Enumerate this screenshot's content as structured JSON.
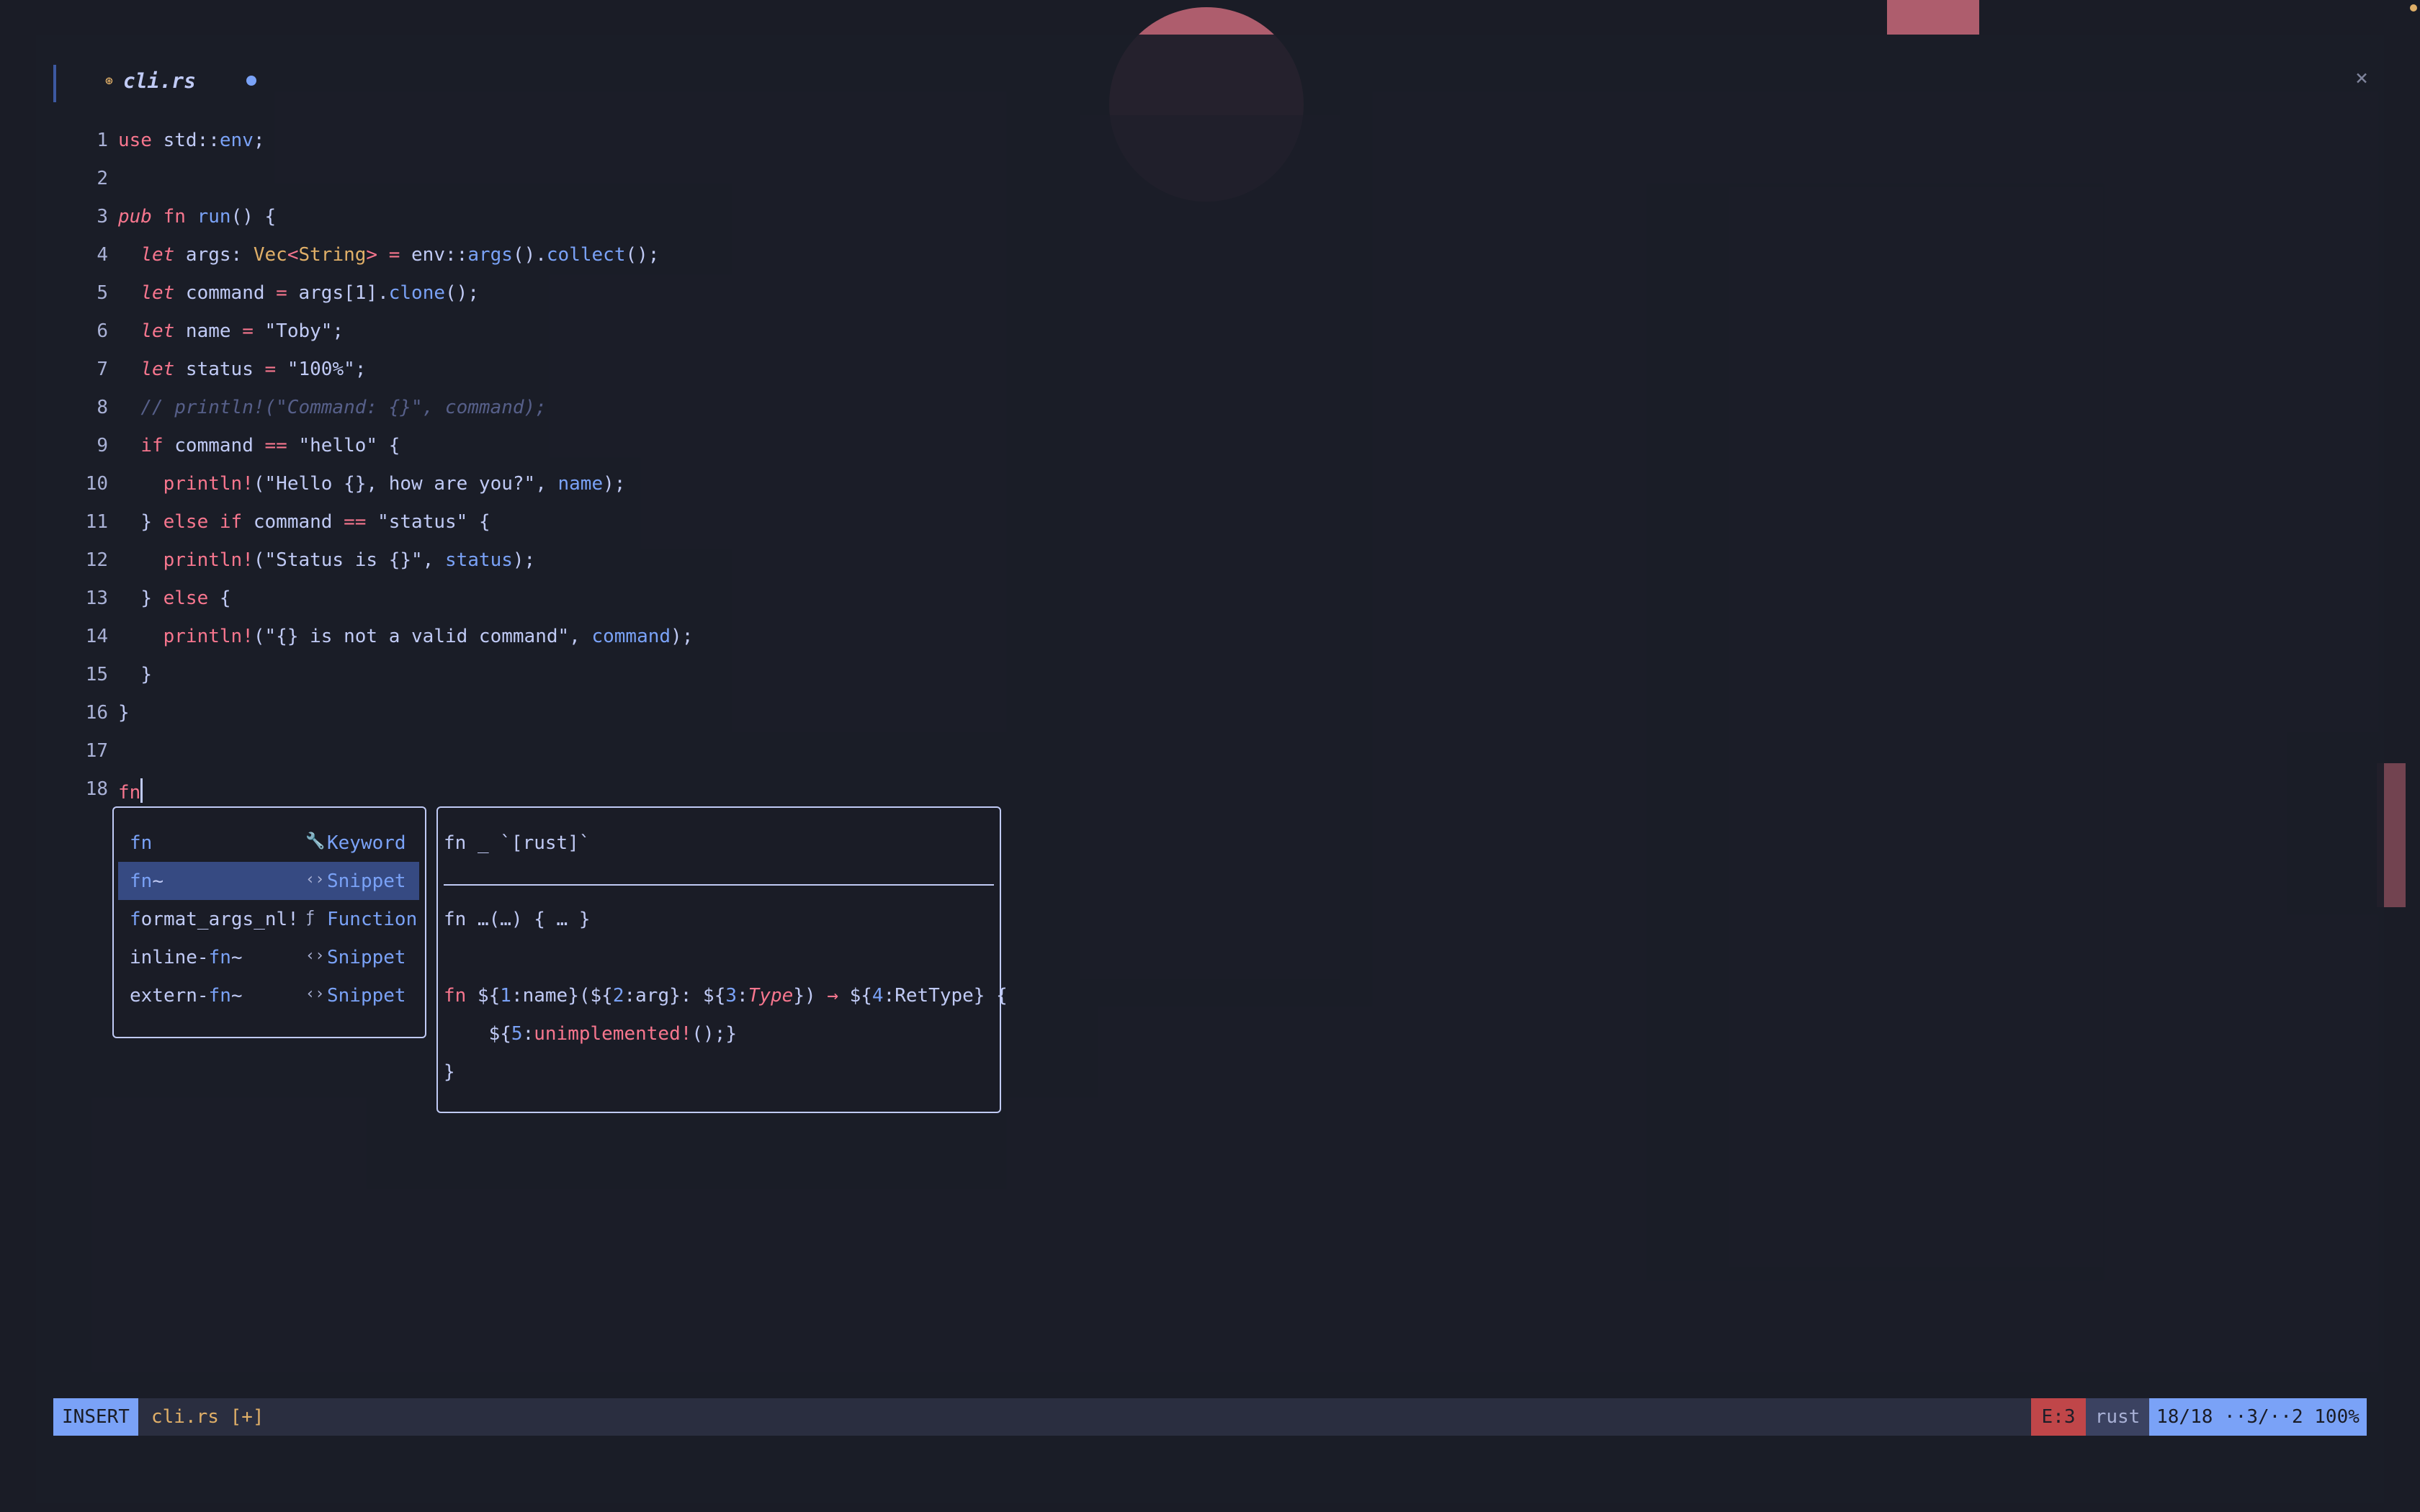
{
  "tab": {
    "file_icon": "⊛",
    "label": "cli.rs",
    "modified_indicator": "●"
  },
  "window": {
    "close_label": "×"
  },
  "editor": {
    "lines": [
      {
        "n": "1"
      },
      {
        "n": "2"
      },
      {
        "n": "3"
      },
      {
        "n": "4"
      },
      {
        "n": "5"
      },
      {
        "n": "6"
      },
      {
        "n": "7"
      },
      {
        "n": "8"
      },
      {
        "n": "9"
      },
      {
        "n": "10"
      },
      {
        "n": "11"
      },
      {
        "n": "12"
      },
      {
        "n": "13"
      },
      {
        "n": "14"
      },
      {
        "n": "15"
      },
      {
        "n": "16"
      },
      {
        "n": "17"
      },
      {
        "n": "18"
      }
    ],
    "code": {
      "l1_use": "use",
      "l1_rest": " std::",
      "l1_env": "env",
      "l1_end": ";",
      "l3_pub": "pub",
      "l3_fn": "fn",
      "l3_run": "run",
      "l3_end": "() {",
      "l4_let": "let",
      "l4_args": " args: ",
      "l4_vec": "Vec",
      "l4_lt": "<",
      "l4_string": "String",
      "l4_gt": ">",
      "l4_eq": " = ",
      "l4_env": "env::",
      "l4_argsfn": "args",
      "l4_p": "().",
      "l4_collect": "collect",
      "l4_end": "();",
      "l5_let": "let",
      "l5_cmd": " command ",
      "l5_eq": "=",
      "l5_args": " args",
      "l5_idx": "[1].",
      "l5_clone": "clone",
      "l5_end": "();",
      "l6_let": "let",
      "l6_name": " name ",
      "l6_eq": "=",
      "l6_val": " \"Toby\";",
      "l7_let": "let",
      "l7_status": " status ",
      "l7_eq": "=",
      "l7_val": " \"100%\";",
      "l8_comment": "// println!(\"Command: {}\", command);",
      "l9_if": "if",
      "l9_cmd": " command ",
      "l9_eq": "==",
      "l9_val": " \"hello\" {",
      "l10_mac": "println!",
      "l10_str": "(\"Hello {}, how are you?\", ",
      "l10_arg": "name",
      "l10_end": ");",
      "l11_close": "} ",
      "l11_else": "else",
      "l11_if": " if",
      "l11_cmd": " command ",
      "l11_eq": "==",
      "l11_val": " \"status\" {",
      "l12_mac": "println!",
      "l12_str": "(\"Status is {}\", ",
      "l12_arg": "status",
      "l12_end": ");",
      "l13_close": "} ",
      "l13_else": "else",
      "l13_end": " {",
      "l14_mac": "println!",
      "l14_str": "(\"{} is not a valid command\", ",
      "l14_arg": "command",
      "l14_end": ");",
      "l15": "}",
      "l16": "}",
      "l18_fn": "fn"
    }
  },
  "completion": {
    "items": [
      {
        "label_m": "fn",
        "label_r": "",
        "icon": "🔧",
        "kind": "Keyword"
      },
      {
        "label_m": "fn",
        "label_r": "~",
        "icon": "‹›",
        "kind": "Snippet"
      },
      {
        "label_m": "f",
        "label_r": "ormat_args_nl!",
        "icon": "ƒ",
        "kind": "Function"
      },
      {
        "label_l": "inline-",
        "label_m": "fn",
        "label_r": "~",
        "icon": "‹›",
        "kind": "Snippet"
      },
      {
        "label_l": "extern-",
        "label_m": "fn",
        "label_r": "~",
        "icon": "‹›",
        "kind": "Snippet"
      }
    ]
  },
  "docs": {
    "signature": "fn _ `[rust]`",
    "summary": "fn …(…) { … }",
    "l1_fn": "fn",
    "l1_a": " ${",
    "l1_n1": "1",
    "l1_b": ":name}(${",
    "l1_n2": "2",
    "l1_c": ":arg}: ${",
    "l1_n3": "3",
    "l1_d": ":",
    "l1_type": "Type",
    "l1_e": "}) ",
    "l1_arrow": "→",
    "l1_f": " ${",
    "l1_n4": "4",
    "l1_g": ":RetType} {",
    "l2_a": "    ${",
    "l2_n5": "5",
    "l2_b": ":",
    "l2_mac": "unimplemented!",
    "l2_c": "();}",
    "l3": "}"
  },
  "status": {
    "mode": "INSERT",
    "file": "cli.rs [+]",
    "errors": "E:3",
    "language": "rust",
    "position": "18/18 ··3/··2 100%"
  },
  "colors": {
    "accent": "#7aa2f7",
    "keyword": "#f7768e",
    "type": "#e0af68",
    "background": "#1b1d28",
    "selection": "#364a82"
  }
}
